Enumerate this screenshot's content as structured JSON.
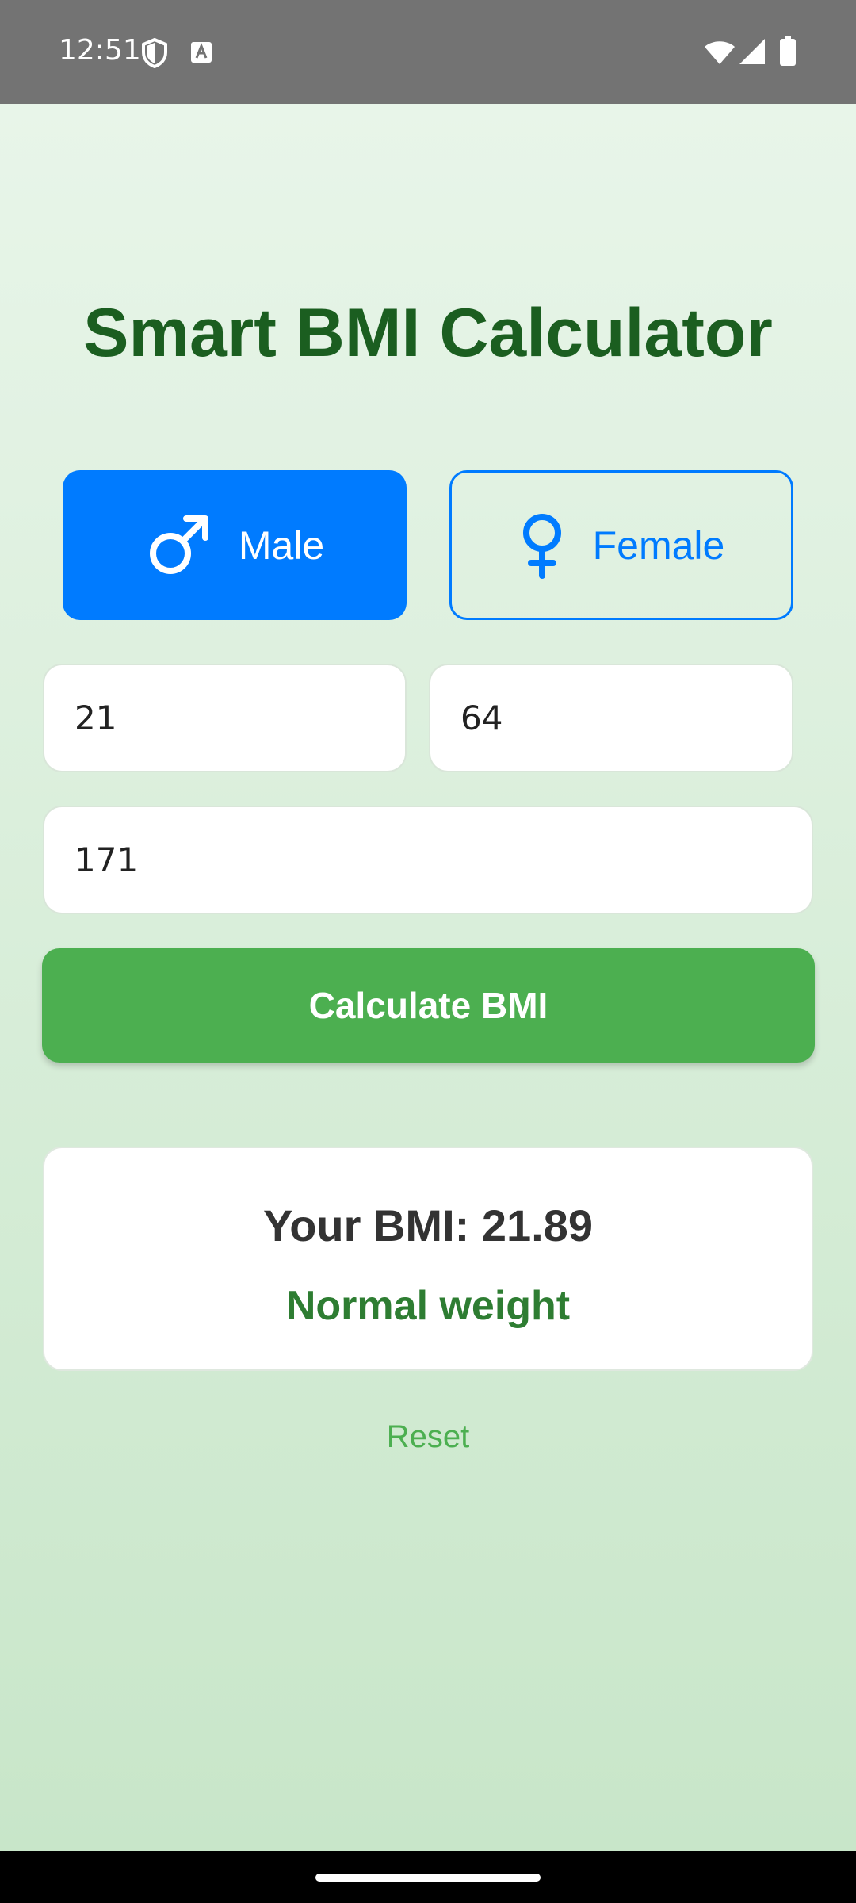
{
  "status_bar": {
    "time": "12:51",
    "icons": [
      "shield-icon",
      "keyboard-a-icon",
      "wifi-icon",
      "signal-icon",
      "battery-icon"
    ]
  },
  "app": {
    "title": "Smart BMI Calculator",
    "gender": {
      "options": [
        {
          "label": "Male",
          "icon": "male-icon",
          "selected": true
        },
        {
          "label": "Female",
          "icon": "female-icon",
          "selected": false
        }
      ]
    },
    "inputs": {
      "age_value": "21",
      "weight_value": "64",
      "height_value": "171"
    },
    "calculate_label": "Calculate BMI",
    "result": {
      "bmi_text": "Your BMI: 21.89",
      "category": "Normal weight"
    },
    "reset_label": "Reset"
  },
  "colors": {
    "title": "#1b5e20",
    "selected_gender": "#007bff",
    "calculate_button": "#4caf50",
    "category_text": "#2e7d32",
    "background_top": "#e8f5e9",
    "background_bottom": "#c8e6c9"
  }
}
